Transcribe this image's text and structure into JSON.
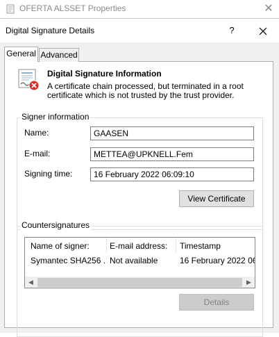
{
  "background_window": {
    "title": "OFERTA ALSSET Properties"
  },
  "dialog": {
    "title": "Digital Signature Details",
    "help": "?",
    "tabs": [
      {
        "label": "General"
      },
      {
        "label": "Advanced"
      }
    ],
    "info": {
      "title": "Digital Signature Information",
      "description": "A certificate chain processed, but terminated in a root certificate which is not trusted by the trust provider."
    },
    "signer": {
      "legend": "Signer information",
      "name_label": "Name:",
      "name_value": "GAASEN",
      "email_label": "E-mail:",
      "email_value": "METTEA@UPKNELL.Fem",
      "time_label": "Signing time:",
      "time_value": "16 February 2022 06:09:10",
      "view_certificate": "View Certificate"
    },
    "countersignatures": {
      "legend": "Countersignatures",
      "columns": [
        "Name of signer:",
        "E-mail address:",
        "Timestamp"
      ],
      "rows": [
        [
          "Symantec SHA256 ...",
          "Not available",
          "16 February 2022 06..."
        ]
      ],
      "details": "Details"
    }
  },
  "icons": {
    "background": "document-icon",
    "certificate": "certificate-error-icon",
    "close": "close-icon"
  }
}
